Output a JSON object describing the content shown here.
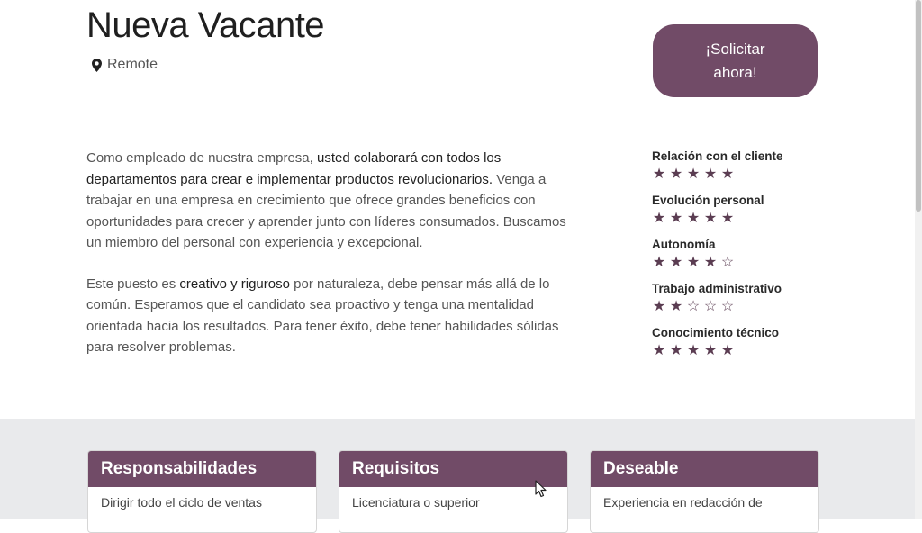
{
  "job": {
    "title": "Nueva Vacante",
    "location": "Remote",
    "apply_label": "¡Solicitar ahora!"
  },
  "description": {
    "p1_a": "Como empleado de nuestra empresa, ",
    "p1_b": "usted colaborará con todos los departamentos para crear e implementar productos revolucionarios.",
    "p1_c": " Venga a trabajar en una empresa en crecimiento que ofrece grandes beneficios con oportunidades para crecer y aprender junto con líderes consumados. Buscamos un miembro del personal con experiencia y excepcional.",
    "p2_a": "Este puesto es ",
    "p2_b": "creativo y riguroso",
    "p2_c": " por naturaleza, debe pensar más allá de lo común. Esperamos que el candidato sea proactivo y tenga una mentalidad orientada hacia los resultados. Para tener éxito, debe tener habilidades sólidas para resolver problemas."
  },
  "ratings": [
    {
      "label": "Relación con el cliente",
      "stars": 5,
      "max": 5
    },
    {
      "label": "Evolución personal",
      "stars": 5,
      "max": 5
    },
    {
      "label": "Autonomía",
      "stars": 4,
      "max": 5
    },
    {
      "label": "Trabajo administrativo",
      "stars": 2,
      "max": 5
    },
    {
      "label": "Conocimiento técnico",
      "stars": 5,
      "max": 5
    }
  ],
  "cards": [
    {
      "title": "Responsabilidades",
      "first_item": "Dirigir todo el ciclo de ventas"
    },
    {
      "title": "Requisitos",
      "first_item": "Licenciatura o superior"
    },
    {
      "title": "Deseable",
      "first_item": "Experiencia en redacción de"
    }
  ],
  "colors": {
    "accent": "#714b67",
    "band": "#e9eaec"
  }
}
